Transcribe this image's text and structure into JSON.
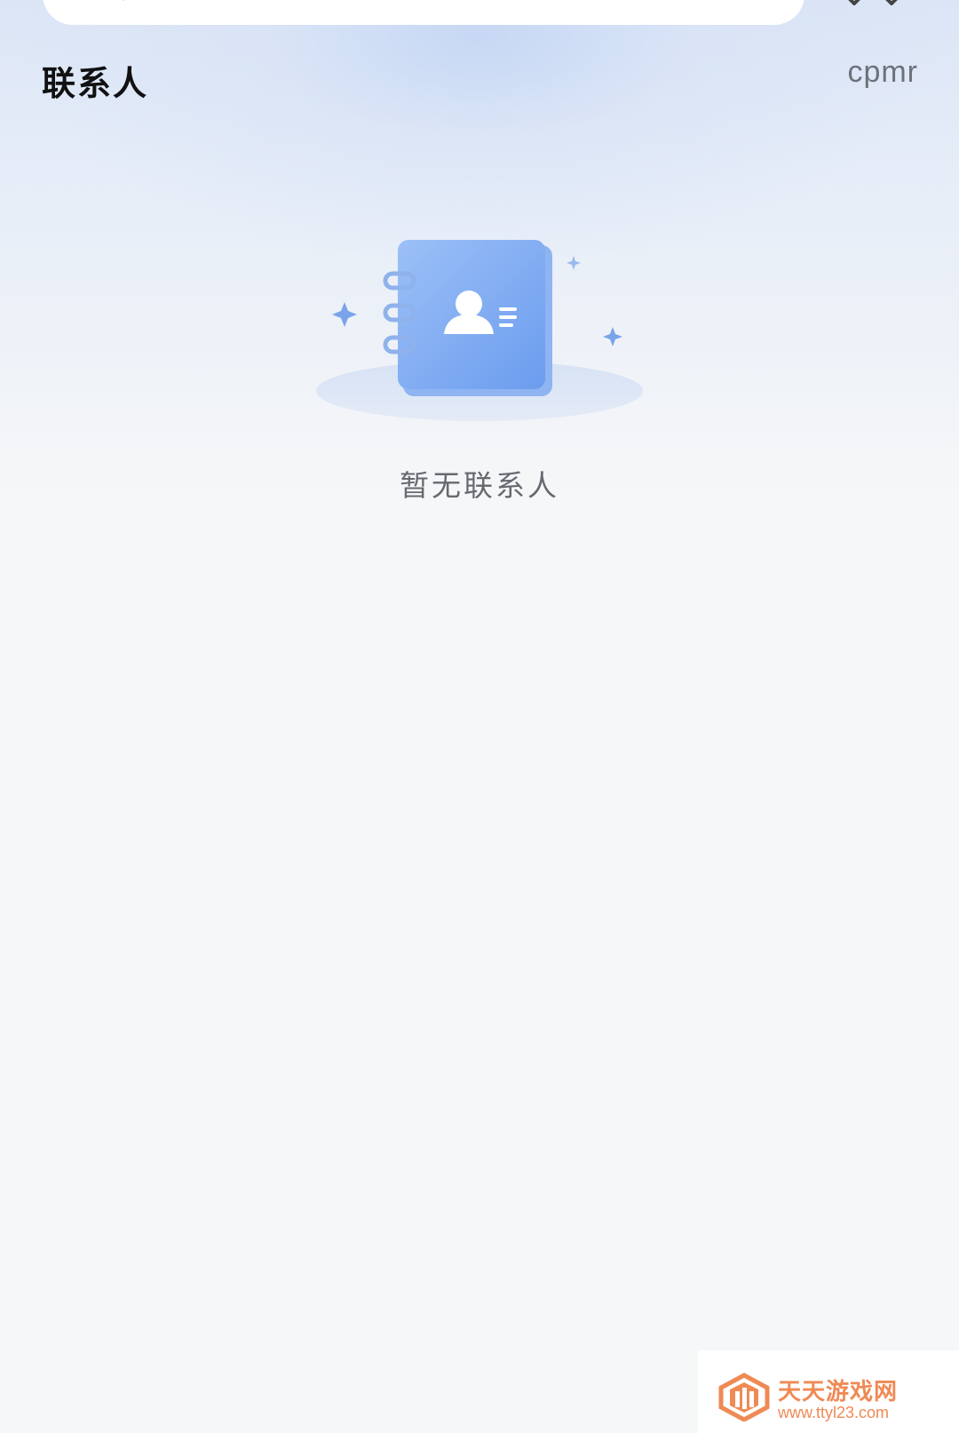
{
  "header": {
    "title": "联系人",
    "right_text": "cpmr"
  },
  "search": {
    "icon": "search-icon"
  },
  "empty_state": {
    "illustration": "contact-book-icon",
    "message": "暂无联系人"
  },
  "watermark": {
    "title": "天天游戏网",
    "url": "www.ttyl23.com",
    "logo": "ttyl-logo-icon"
  },
  "colors": {
    "background": "#f6f7f8",
    "accent_blue": "#6e9ef0",
    "title_text": "#111111",
    "muted_text": "#666a70",
    "watermark_orange": "#ef8a55"
  }
}
